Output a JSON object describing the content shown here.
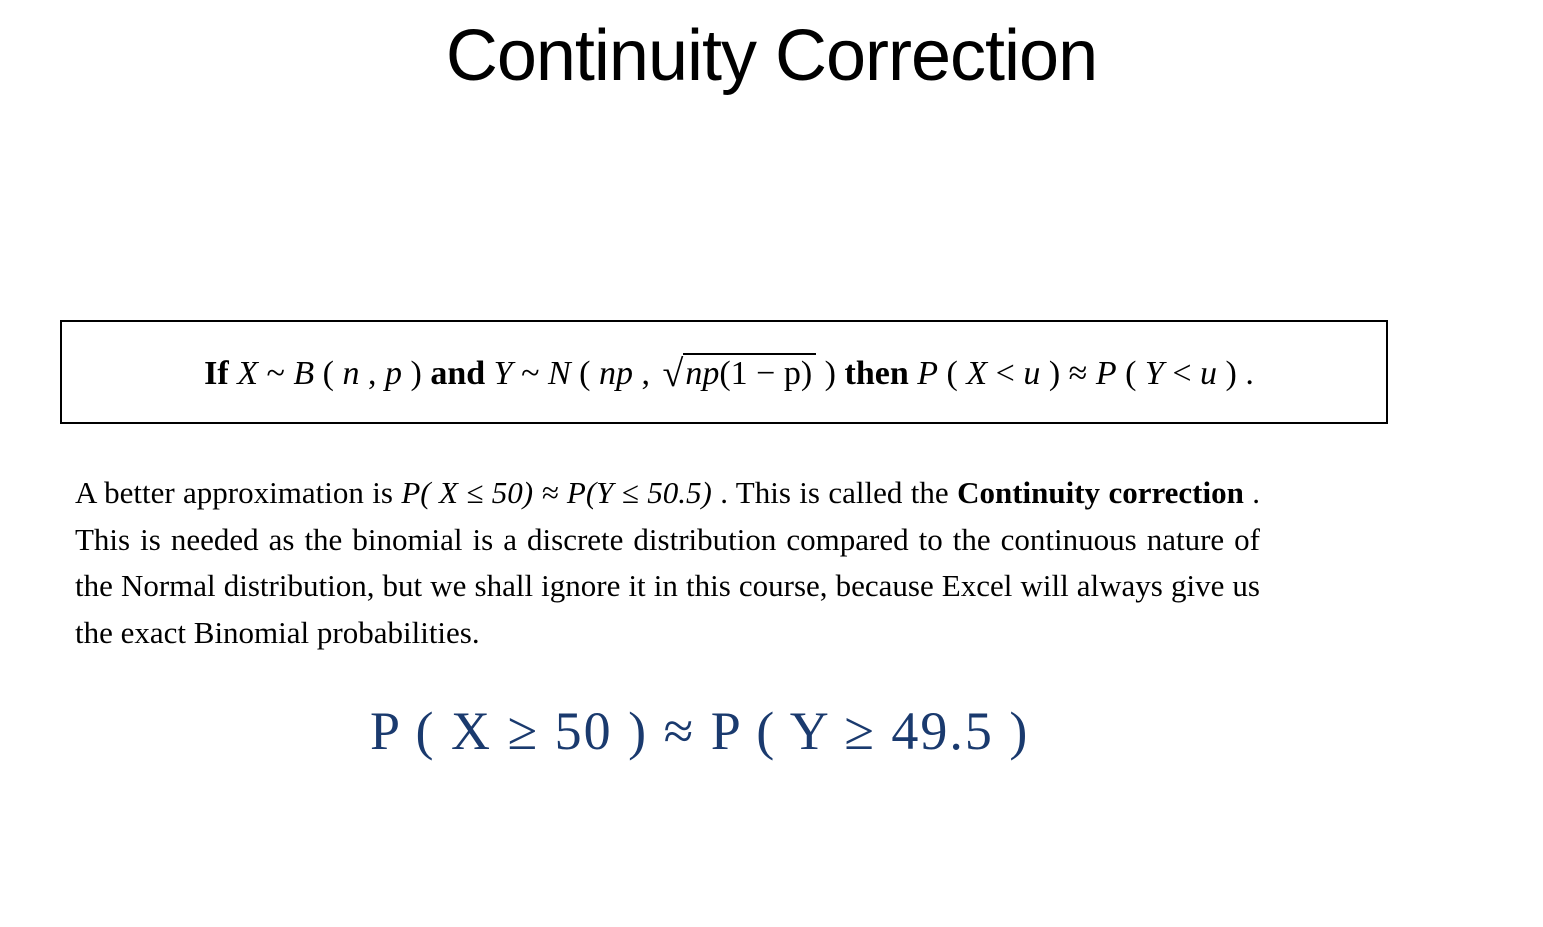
{
  "title": "Continuity Correction",
  "rule": {
    "if": "If ",
    "x_dist": "X ~ B(n, p)",
    "and": " and ",
    "y_dist_pre": "Y ~ N(np, ",
    "y_dist_rad": "np(1 − p)",
    "y_dist_post": ")",
    "then": " then ",
    "prob": "P(X < u) ≈ P(Y < u).",
    "x_var": "X",
    "tilde": " ~ ",
    "b_open": "B",
    "paren_open": "(",
    "n": "n",
    "comma": ", ",
    "p": "p",
    "paren_close": ")",
    "y_var": "Y",
    "n_func": "N",
    "np": "np",
    "one_minus_p": "(1 − p)",
    "px": "P",
    "lt": " < ",
    "u": "u",
    "approx": " ≈ ",
    "period": "."
  },
  "body": {
    "line1_pre": "A better approximation is  ",
    "formula_px": "P( X ≤ 50) ≈ P(Y ≤ 50.5)",
    "line1_post": ". This is called the ",
    "bold1": "Continuity correction",
    "line2": ". This is needed as the binomial is a discrete distribution compared to the continuous nature of the Normal distribution, but we shall ignore it in this course, because Excel will always give us the exact Binomial probabilities."
  },
  "handwriting": "P ( X ≥ 50 )  ≈  P ( Y ≥ 49.5 )"
}
